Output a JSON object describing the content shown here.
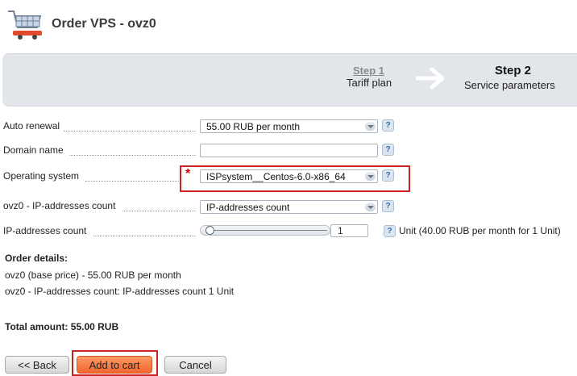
{
  "header": {
    "title": "Order VPS - ovz0",
    "icon": "shopping-cart-icon"
  },
  "steps": [
    {
      "title": "Step 1",
      "subtitle": "Tariff plan",
      "state": "completed-link"
    },
    {
      "title": "Step 2",
      "subtitle": "Service parameters",
      "state": "current"
    }
  ],
  "form": {
    "auto_renewal": {
      "label": "Auto renewal",
      "value": "55.00 RUB per month"
    },
    "domain_name": {
      "label": "Domain name",
      "value": ""
    },
    "operating_system": {
      "label": "Operating system",
      "value": "ISPsystem__Centos-6.0-x86_64",
      "required_mark": "*"
    },
    "ip_count_select": {
      "label": "ovz0 - IP-addresses count",
      "value": "IP-addresses count"
    },
    "ip_count_slider": {
      "label": "IP-addresses count",
      "value": "1",
      "unit_text": "Unit (40.00 RUB per month for 1 Unit)",
      "slider_level": 0.0
    },
    "help_glyph": "?"
  },
  "order_details": {
    "title": "Order details:",
    "lines": [
      "ovz0 (base price) - 55.00 RUB per month",
      "ovz0 - IP-addresses count: IP-addresses count 1 Unit"
    ],
    "total": "Total amount: 55.00 RUB"
  },
  "buttons": {
    "back": "<< Back",
    "add_to_cart": "Add to cart",
    "cancel": "Cancel"
  },
  "colors": {
    "highlight": "#cc2222",
    "primary_button": "#f2662e",
    "steps_bar": "#e2e5ea",
    "required": "#d00000"
  }
}
